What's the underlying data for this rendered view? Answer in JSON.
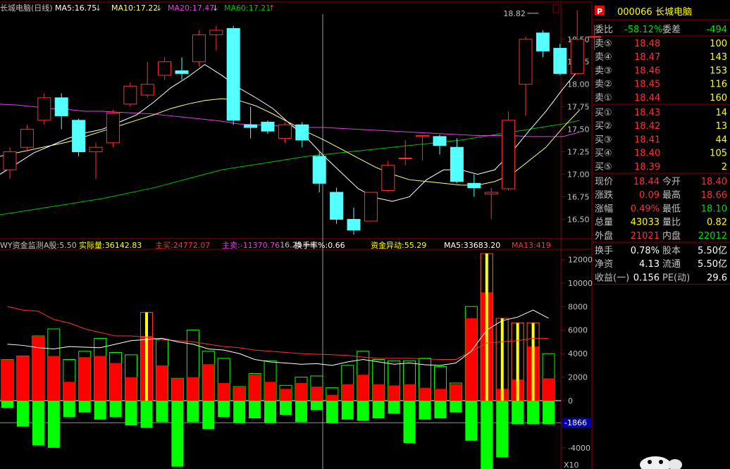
{
  "colors": {
    "up": "#ff3030",
    "down": "#54ffff",
    "ma5": "#ffffff",
    "ma10": "#ffff80",
    "ma20": "#e040e0",
    "ma60": "#00c000",
    "grid": "#8b0000",
    "vol_up": "#ff0000",
    "vol_dn": "#00ff00",
    "yellow": "#ffff00"
  },
  "chart_data": [
    {
      "type": "candlestick",
      "title": "长城电脑(日线)",
      "legend": [
        {
          "label": "MA5:16.75",
          "color": "#ffffff"
        },
        {
          "label": "MA10:17.22",
          "color": "#ffff80"
        },
        {
          "label": "MA20:17.47",
          "color": "#e040e0"
        },
        {
          "label": "MA60:17.21",
          "color": "#00c000"
        }
      ],
      "ylim": [
        16.3,
        18.78
      ],
      "yticks": [
        "18.50",
        "18.25",
        "18.00",
        "17.75",
        "17.50",
        "17.25",
        "17.00",
        "16.75",
        "16.50"
      ],
      "ytick_values": [
        18.5,
        18.25,
        18.0,
        17.75,
        17.5,
        17.25,
        17.0,
        16.75,
        16.5
      ],
      "annotations": [
        {
          "text": "18.82",
          "value": 18.82,
          "index": 31
        },
        {
          "text": "16.25",
          "value": 16.25,
          "index": 18
        }
      ],
      "candles": [
        {
          "o": 17.05,
          "c": 17.25,
          "h": 17.3,
          "l": 16.95
        },
        {
          "o": 17.3,
          "c": 17.5,
          "h": 17.55,
          "l": 17.25
        },
        {
          "o": 17.6,
          "c": 17.85,
          "h": 17.9,
          "l": 17.55
        },
        {
          "o": 17.85,
          "c": 17.65,
          "h": 17.9,
          "l": 17.5
        },
        {
          "o": 17.6,
          "c": 17.25,
          "h": 17.62,
          "l": 17.2
        },
        {
          "o": 17.25,
          "c": 17.3,
          "h": 17.35,
          "l": 16.95
        },
        {
          "o": 17.35,
          "c": 17.68,
          "h": 17.72,
          "l": 17.3
        },
        {
          "o": 17.78,
          "c": 17.98,
          "h": 18.02,
          "l": 17.75
        },
        {
          "o": 17.88,
          "c": 18.0,
          "h": 18.25,
          "l": 17.85
        },
        {
          "o": 18.1,
          "c": 18.25,
          "h": 18.3,
          "l": 18.05
        },
        {
          "o": 18.15,
          "c": 18.12,
          "h": 18.3,
          "l": 18.05
        },
        {
          "o": 18.25,
          "c": 18.55,
          "h": 18.6,
          "l": 18.2
        },
        {
          "o": 18.55,
          "c": 18.6,
          "h": 18.65,
          "l": 18.38
        },
        {
          "o": 18.62,
          "c": 17.6,
          "h": 18.65,
          "l": 17.55
        },
        {
          "o": 17.55,
          "c": 17.52,
          "h": 17.75,
          "l": 17.4
        },
        {
          "o": 17.58,
          "c": 17.48,
          "h": 17.6,
          "l": 17.45
        },
        {
          "o": 17.4,
          "c": 17.55,
          "h": 17.58,
          "l": 17.35
        },
        {
          "o": 17.55,
          "c": 17.38,
          "h": 17.58,
          "l": 17.3
        },
        {
          "o": 17.2,
          "c": 16.9,
          "h": 17.25,
          "l": 16.8
        },
        {
          "o": 16.8,
          "c": 16.5,
          "h": 16.85,
          "l": 16.45
        },
        {
          "o": 16.5,
          "c": 16.38,
          "h": 16.63,
          "l": 16.33
        },
        {
          "o": 16.48,
          "c": 16.8,
          "h": 16.8,
          "l": 16.48
        },
        {
          "o": 16.82,
          "c": 17.1,
          "h": 17.15,
          "l": 16.8
        },
        {
          "o": 17.18,
          "c": 17.18,
          "h": 17.38,
          "l": 17.1
        },
        {
          "o": 17.42,
          "c": 17.43,
          "h": 17.43,
          "l": 17.15
        },
        {
          "o": 17.42,
          "c": 17.32,
          "h": 17.44,
          "l": 17.22
        },
        {
          "o": 17.3,
          "c": 16.92,
          "h": 17.4,
          "l": 16.9
        },
        {
          "o": 16.9,
          "c": 16.85,
          "h": 17.0,
          "l": 16.75
        },
        {
          "o": 16.78,
          "c": 16.8,
          "h": 16.85,
          "l": 16.5
        },
        {
          "o": 16.84,
          "c": 17.6,
          "h": 17.7,
          "l": 16.82
        },
        {
          "o": 18.0,
          "c": 18.5,
          "h": 18.53,
          "l": 17.65
        },
        {
          "o": 18.57,
          "c": 18.37,
          "h": 18.6,
          "l": 18.3
        },
        {
          "o": 18.4,
          "c": 18.12,
          "h": 18.45,
          "l": 18.1
        },
        {
          "o": 18.12,
          "c": 18.5,
          "h": 18.82,
          "l": 18.12
        },
        {
          "o": 18.53,
          "c": 18.53,
          "h": 18.66,
          "l": 18.38
        }
      ],
      "ma5": [
        17.0,
        17.12,
        17.24,
        17.32,
        17.4,
        17.46,
        17.5,
        17.58,
        17.66,
        17.8,
        17.96,
        18.08,
        18.22,
        18.1,
        17.96,
        17.85,
        17.73,
        17.56,
        17.4,
        17.2,
        17.02,
        16.84,
        16.74,
        16.7,
        16.75,
        16.94,
        17.05,
        17.05,
        17.0,
        17.05,
        17.25,
        17.48,
        17.7,
        17.95,
        18.18
      ],
      "ma10": [
        17.2,
        17.24,
        17.28,
        17.32,
        17.36,
        17.42,
        17.48,
        17.54,
        17.6,
        17.66,
        17.73,
        17.78,
        17.82,
        17.84,
        17.82,
        17.76,
        17.67,
        17.57,
        17.47,
        17.38,
        17.28,
        17.18,
        17.08,
        17.0,
        16.94,
        16.92,
        16.9,
        16.88,
        16.88,
        16.92,
        17.0,
        17.15,
        17.3,
        17.52,
        17.72
      ],
      "ma20": [
        17.78,
        17.77,
        17.75,
        17.73,
        17.72,
        17.7,
        17.7,
        17.69,
        17.68,
        17.67,
        17.65,
        17.63,
        17.61,
        17.59,
        17.56,
        17.55,
        17.54,
        17.53,
        17.52,
        17.52,
        17.51,
        17.5,
        17.49,
        17.48,
        17.47,
        17.46,
        17.45,
        17.44,
        17.43,
        17.43,
        17.43,
        17.42,
        17.42,
        17.42,
        17.47
      ],
      "ma60": [
        16.55,
        16.58,
        16.61,
        16.64,
        16.67,
        16.7,
        16.73,
        16.77,
        16.81,
        16.85,
        16.9,
        16.95,
        17.0,
        17.05,
        17.08,
        17.11,
        17.14,
        17.17,
        17.2,
        17.22,
        17.24,
        17.26,
        17.28,
        17.3,
        17.32,
        17.34,
        17.36,
        17.38,
        17.41,
        17.44,
        17.47,
        17.5,
        17.53,
        17.56,
        17.6
      ]
    },
    {
      "type": "bar",
      "title": "WY资金监测",
      "legend": [
        {
          "label": "A股:5.50",
          "color": "#c0c0c0"
        },
        {
          "label": "实际量:36142.83",
          "color": "#ffff00"
        },
        {
          "label": "主买:24772.07",
          "color": "#ff3030"
        },
        {
          "label": "主卖:-11370.76",
          "color": "#e040e0"
        },
        {
          "label": "换手率%:0.66",
          "color": "#ffffff"
        },
        {
          "label": "资金异动:55.29",
          "color": "#ffff00"
        },
        {
          "label": "MA5:33683.20",
          "color": "#ffffff"
        },
        {
          "label": "MA13:419",
          "color": "#ff3030"
        }
      ],
      "ylim": [
        -5800,
        12800
      ],
      "yticks": [
        "12000",
        "10000",
        "8000",
        "6000",
        "4000",
        "2000",
        "0",
        "-2000",
        "-4000"
      ],
      "ytick_values": [
        12000,
        10000,
        8000,
        6000,
        4000,
        2000,
        0,
        -2000,
        -4000
      ],
      "current_value": "-1866",
      "current_line_value": -1866,
      "corner_label": "X10",
      "buy": [
        3500,
        3800,
        5500,
        3800,
        1600,
        3700,
        3800,
        3200,
        2000,
        5500,
        3000,
        1900,
        2000,
        3100,
        1500,
        1200,
        2200,
        1600,
        1000,
        1500,
        1200,
        500,
        1400,
        2200,
        1400,
        1300,
        1400,
        1100,
        1000,
        1400,
        7000,
        9200,
        1000,
        1800,
        4600,
        1900
      ],
      "outline": [
        3500,
        3800,
        5500,
        6100,
        3500,
        4200,
        5300,
        4100,
        3900,
        7500,
        5200,
        1900,
        6000,
        4200,
        3600,
        1200,
        2300,
        3400,
        1300,
        2000,
        2100,
        1100,
        3000,
        4200,
        3500,
        3400,
        3400,
        3600,
        2900,
        1500,
        8000,
        12500,
        7000,
        6600,
        6600,
        4000
      ],
      "sell": [
        -600,
        -2200,
        -3800,
        -4000,
        -1400,
        -1000,
        -1600,
        -1400,
        -2100,
        -2300,
        -1800,
        -5600,
        -1800,
        -2400,
        -1400,
        -1900,
        -1500,
        -1900,
        -1200,
        -1800,
        -800,
        -1900,
        -1600,
        -1700,
        -1500,
        -1100,
        -3600,
        -1600,
        -1500,
        -1000,
        -3400,
        -5800,
        -4800,
        -2000,
        -2000,
        -2000
      ],
      "yellow_idx": [
        9,
        31,
        32,
        33,
        34
      ],
      "ma5": [
        4800,
        4700,
        4500,
        4400,
        4600,
        4550,
        4500,
        4800,
        5100,
        5200,
        5300,
        5000,
        4800,
        4400,
        4300,
        4000,
        3500,
        3300,
        3200,
        3100,
        3150,
        3000,
        3300,
        3500,
        3300,
        3100,
        3200,
        3050,
        3000,
        3200,
        4200,
        6000,
        6800,
        7100,
        7700,
        7000
      ],
      "ma13": [
        8000,
        7700,
        7600,
        6900,
        6600,
        6100,
        5800,
        5500,
        5500,
        5400,
        5200,
        5100,
        5000,
        4800,
        4600,
        4500,
        4300,
        4200,
        4100,
        4000,
        3950,
        3900,
        3850,
        3700,
        3600,
        3600,
        3600,
        3550,
        3500,
        3500,
        4200,
        4900,
        5000,
        5100,
        5300,
        5300
      ]
    }
  ],
  "quote": {
    "code": "000066",
    "name": "长城电脑",
    "webi_label": "委比",
    "webi": "-58.12%",
    "weicha_label": "委差",
    "weicha": "-494",
    "asks": [
      {
        "label": "卖⑤",
        "price": "18.48",
        "vol": "100"
      },
      {
        "label": "卖④",
        "price": "18.47",
        "vol": "143"
      },
      {
        "label": "卖③",
        "price": "18.46",
        "vol": "153"
      },
      {
        "label": "卖②",
        "price": "18.45",
        "vol": "116"
      },
      {
        "label": "卖①",
        "price": "18.44",
        "vol": "160"
      }
    ],
    "bids": [
      {
        "label": "买①",
        "price": "18.43",
        "vol": "14"
      },
      {
        "label": "买②",
        "price": "18.42",
        "vol": "13"
      },
      {
        "label": "买③",
        "price": "18.41",
        "vol": "44"
      },
      {
        "label": "买④",
        "price": "18.40",
        "vol": "105"
      },
      {
        "label": "买⑤",
        "price": "18.39",
        "vol": "2"
      }
    ],
    "stats1": [
      {
        "l1": "现价",
        "v1": "18.44",
        "c1": "red",
        "l2": "今开",
        "v2": "18.40",
        "c2": "red"
      },
      {
        "l1": "涨跌",
        "v1": "0.09",
        "c1": "red",
        "l2": "最高",
        "v2": "18.66",
        "c2": "red"
      },
      {
        "l1": "涨幅",
        "v1": "0.49%",
        "c1": "red",
        "l2": "最低",
        "v2": "18.10",
        "c2": "grn"
      },
      {
        "l1": "总量",
        "v1": "43033",
        "c1": "yel",
        "l2": "量比",
        "v2": "0.82",
        "c2": "yel"
      },
      {
        "l1": "外盘",
        "v1": "21021",
        "c1": "red",
        "l2": "内盘",
        "v2": "22012",
        "c2": "grn"
      }
    ],
    "stats2": [
      {
        "l1": "换手",
        "v1": "0.78%",
        "l2": "股本",
        "v2": "5.50亿"
      },
      {
        "l1": "净资",
        "v1": "4.13",
        "l2": "流通",
        "v2": "5.50亿"
      },
      {
        "l1": "收益(一)",
        "v1": "0.156",
        "l2": "PE(动)",
        "v2": "29.6"
      }
    ]
  }
}
